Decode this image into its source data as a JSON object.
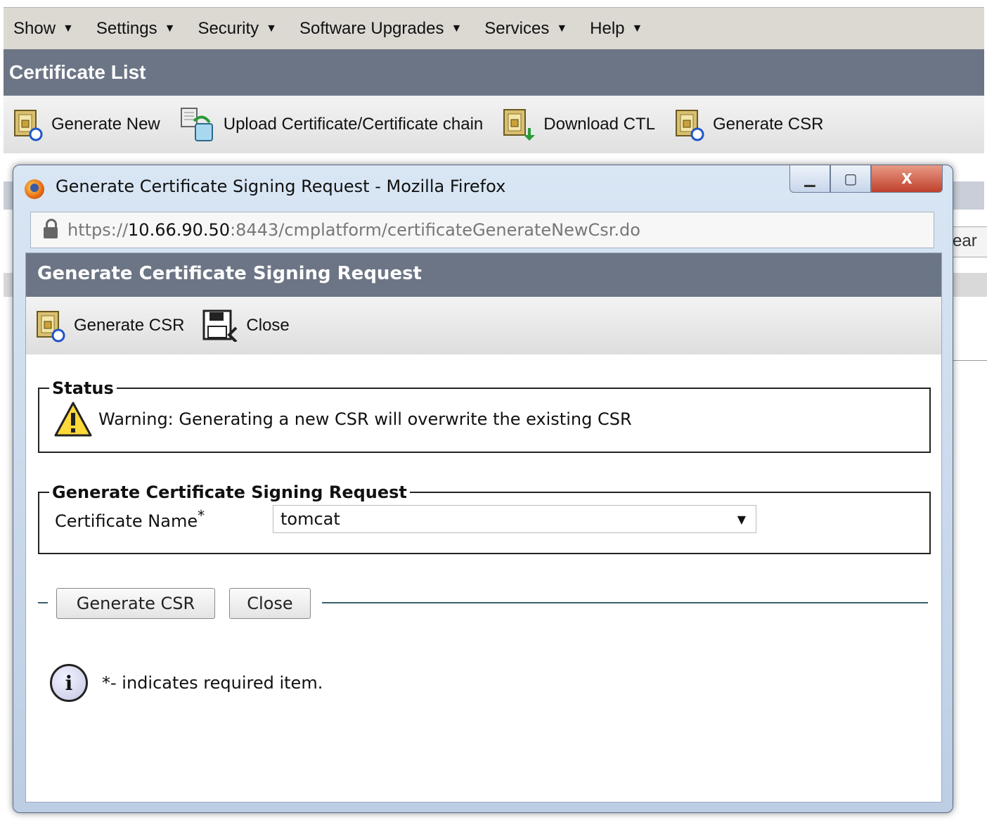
{
  "menu": [
    {
      "label": "Show"
    },
    {
      "label": "Settings"
    },
    {
      "label": "Security"
    },
    {
      "label": "Software Upgrades"
    },
    {
      "label": "Services"
    },
    {
      "label": "Help"
    }
  ],
  "page": {
    "title": "Certificate List",
    "toolbar": [
      {
        "label": "Generate New",
        "icon": "certificate-refresh-icon"
      },
      {
        "label": "Upload Certificate/Certificate chain",
        "icon": "upload-icon"
      },
      {
        "label": "Download CTL",
        "icon": "certificate-download-icon"
      },
      {
        "label": "Generate CSR",
        "icon": "certificate-refresh-icon"
      }
    ],
    "partial_button": "ear"
  },
  "popup": {
    "window_title": "Generate Certificate Signing Request - Mozilla Firefox",
    "url_prefix": "https://",
    "url_host": "10.66.90.50",
    "url_rest": ":8443/cmplatform/certificateGenerateNewCsr.do",
    "header": "Generate Certificate Signing Request",
    "toolbar": {
      "generate_label": "Generate CSR",
      "close_label": "Close"
    },
    "status": {
      "legend": "Status",
      "warning": "Warning: Generating a new CSR will overwrite the existing CSR"
    },
    "form": {
      "legend": "Generate Certificate Signing Request",
      "cert_name_label": "Certificate Name",
      "required_mark": "*",
      "cert_name_value": "tomcat"
    },
    "buttons": {
      "generate": "Generate CSR",
      "close": "Close"
    },
    "note": "*- indicates required item."
  },
  "colors": {
    "header_bg": "#6c7585",
    "menubar_bg": "#dcd9d3",
    "rule": "#37606a"
  }
}
